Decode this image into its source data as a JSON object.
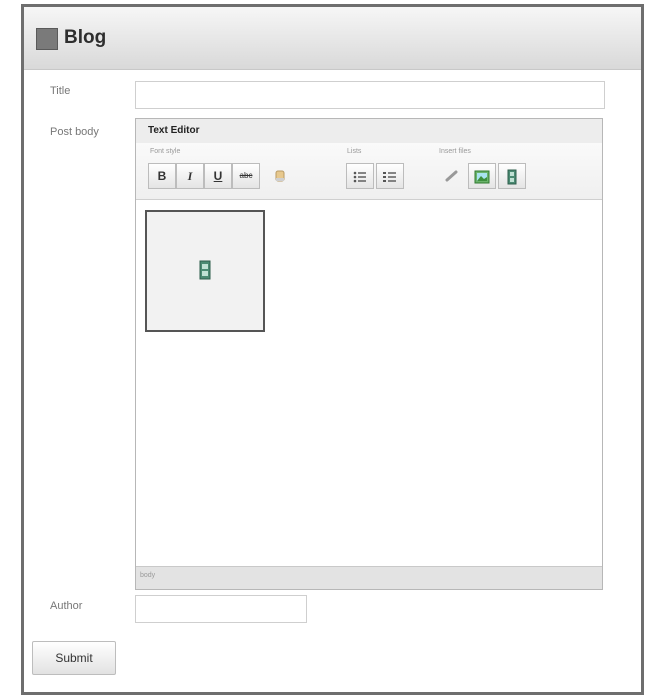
{
  "header": {
    "title": "Blog"
  },
  "form": {
    "title_label": "Title",
    "title_value": "",
    "body_label": "Post body",
    "author_label": "Author",
    "author_value": ""
  },
  "editor": {
    "title": "Text Editor",
    "groups": {
      "font_style": "Font style",
      "lists": "Lists",
      "insert": "Insert files"
    },
    "buttons": {
      "bold": "B",
      "italic": "I",
      "underline": "U",
      "strike": "abc"
    },
    "status": "body"
  },
  "submit_label": "Submit"
}
